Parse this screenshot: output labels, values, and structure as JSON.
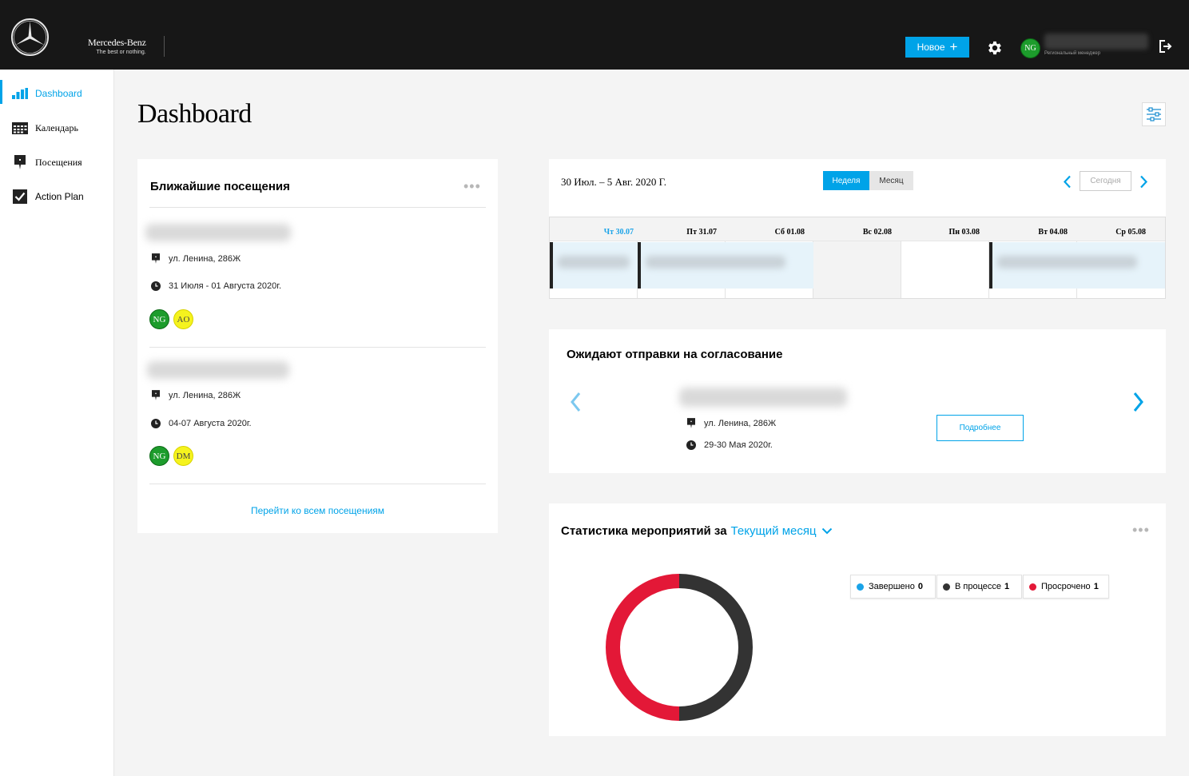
{
  "header": {
    "brand_name": "Mercedes-Benz",
    "brand_tagline": "The best or nothing.",
    "new_button": "Новое",
    "user_initials": "NG",
    "user_role": "Региональный менеджер"
  },
  "sidebar": {
    "items": [
      {
        "label": "Dashboard",
        "active": true
      },
      {
        "label": "Календарь",
        "active": false
      },
      {
        "label": "Посещения",
        "active": false
      },
      {
        "label": "Action Plan",
        "active": false
      }
    ]
  },
  "main": {
    "page_title": "Dashboard"
  },
  "visits_card": {
    "title": "Ближайшие посещения",
    "visits": [
      {
        "address": "ул. Ленина, 286Ж",
        "dates": "31 Июля - 01 Августа 2020г.",
        "participants": [
          "NG",
          "AO"
        ]
      },
      {
        "address": "ул. Ленина, 286Ж",
        "dates": "04-07 Августа 2020г.",
        "participants": [
          "NG",
          "DM"
        ]
      }
    ],
    "all_link": "Перейти ко всем посещениям"
  },
  "calendar": {
    "range": "30 Июл. – 5 Авг. 2020 Г.",
    "view_week": "Неделя",
    "view_month": "Месяц",
    "today": "Сегодня",
    "days": [
      {
        "label": "Чт 30.07",
        "current": true
      },
      {
        "label": "Пт 31.07",
        "current": false
      },
      {
        "label": "Сб 01.08",
        "current": false
      },
      {
        "label": "Вс 02.08",
        "current": false
      },
      {
        "label": "Пн 03.08",
        "current": false
      },
      {
        "label": "Вт 04.08",
        "current": false
      },
      {
        "label": "Ср 05.08",
        "current": false
      }
    ]
  },
  "pending_card": {
    "title": "Ожидают отправки на согласование",
    "address": "ул. Ленина, 286Ж",
    "dates": "29-30 Мая 2020г.",
    "details_button": "Подробнее"
  },
  "stats_card": {
    "title_prefix": "Статистика мероприятий за",
    "period": "Текущий месяц",
    "legend": [
      {
        "label": "Завершено",
        "count": "0",
        "color": "#1aa3e8"
      },
      {
        "label": "В процессе",
        "count": "1",
        "color": "#333333"
      },
      {
        "label": "Просрочено",
        "count": "1",
        "color": "#e31837"
      }
    ]
  },
  "colors": {
    "accent": "#00a3e8",
    "header_bg": "#171717",
    "avatar_green": "#1d9c2c",
    "avatar_yellow": "#f5f31e",
    "done": "#1aa3e8",
    "in_progress": "#333333",
    "overdue": "#e31837"
  },
  "icons": [
    "mercedes-star-icon",
    "plus-icon",
    "gear-icon",
    "logout-icon",
    "bar-chart-icon",
    "calendar-icon",
    "map-pin-icon",
    "checkbox-icon",
    "filter-icon",
    "more-dots-icon",
    "clock-icon",
    "chevron-left-icon",
    "chevron-right-icon",
    "chevron-down-icon"
  ]
}
